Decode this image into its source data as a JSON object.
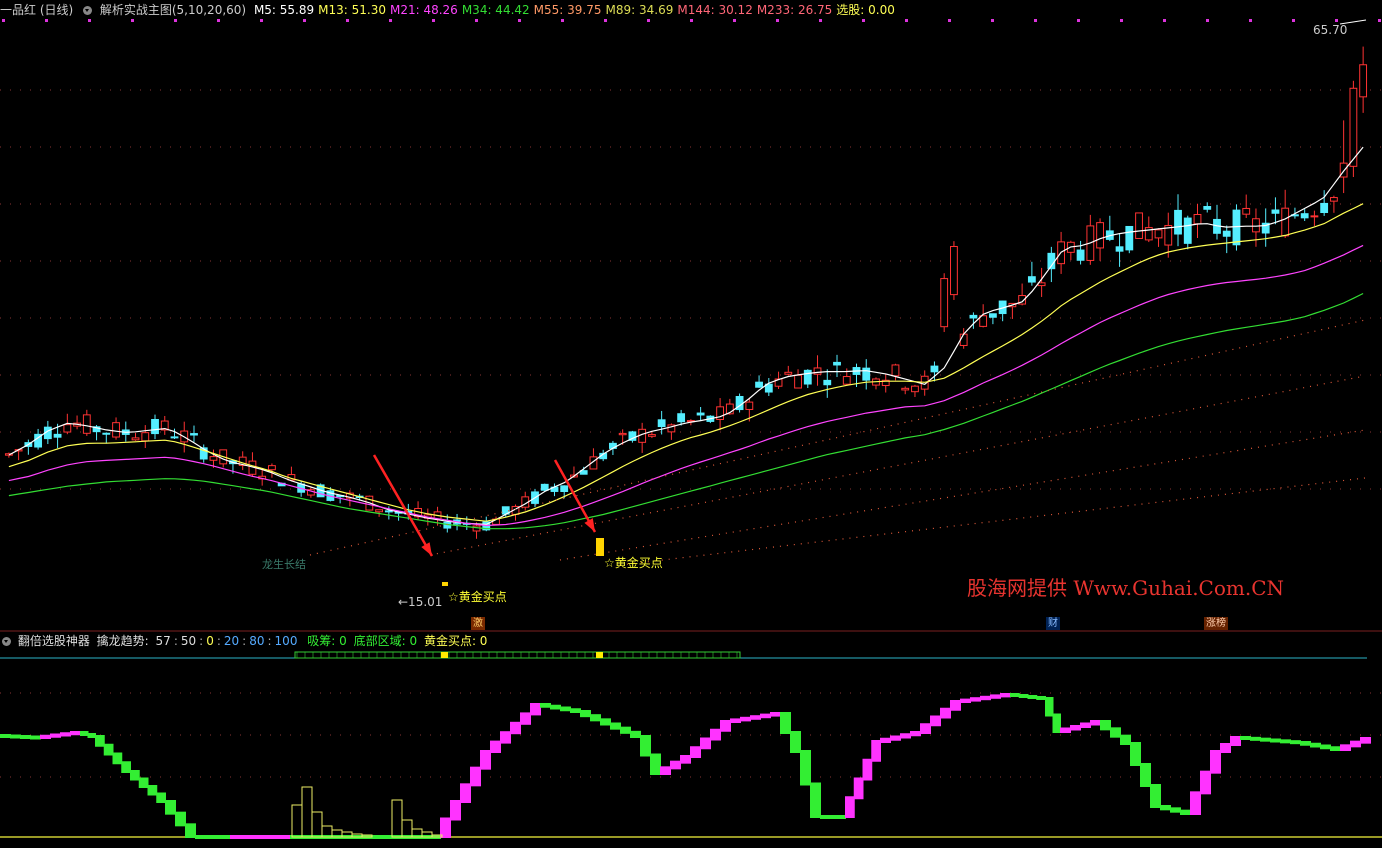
{
  "main_header": {
    "stock": "一品红 (日线)",
    "indicator": "解析实战主图(5,10,20,60)",
    "ma": [
      {
        "label": "M5: 55.89",
        "color": "#ffffff"
      },
      {
        "label": "M13: 51.30",
        "color": "#ffff55"
      },
      {
        "label": "M21: 48.26",
        "color": "#ff44ff"
      },
      {
        "label": "M34: 44.42",
        "color": "#33dd33"
      },
      {
        "label": "M55: 39.75",
        "color": "#ff9966"
      },
      {
        "label": "M89: 34.69",
        "color": "#dddd55"
      },
      {
        "label": "M144: 30.12",
        "color": "#ff6677"
      },
      {
        "label": "M233: 26.75",
        "color": "#ff6677"
      },
      {
        "label": "选股: 0.00",
        "color": "#ffff55"
      }
    ]
  },
  "annotations": {
    "high_price": "65.70",
    "low_price": "←15.01",
    "gold_buy_1": "☆黄金买点",
    "gold_buy_2": "☆黄金买点",
    "faded_label": "龙生长结",
    "event_1": "激",
    "event_2": "财",
    "event_3": "涨榜"
  },
  "watermark": "股海网提供 Www.Guhai.Com.CN",
  "sub_header": {
    "indicator": "翻倍选股神器",
    "trend_label": "擒龙趋势:",
    "levels": [
      {
        "text": "57",
        "color": "#dddddd"
      },
      {
        "text": "50",
        "color": "#dddddd"
      },
      {
        "text": "0",
        "color": "#ffff55"
      },
      {
        "text": "20",
        "color": "#55aaff"
      },
      {
        "text": "80",
        "color": "#55aaff"
      },
      {
        "text": "100",
        "color": "#55aaff"
      }
    ],
    "absorb": "吸筹: 0",
    "bottom_zone": "底部区域: 0",
    "gold_point": "黄金买点: 0"
  },
  "colors": {
    "up": "#ff3333",
    "down": "#55eeff",
    "ma5": "#ffffff",
    "ma13": "#ffff55",
    "ma21": "#ff44ff",
    "ma34": "#33dd33",
    "trend_up": "#ff33ff",
    "trend_down": "#33ee33",
    "grid_dot": "#883333",
    "watermark": "#e8342f"
  },
  "chart_data": {
    "type": "candlestick",
    "ylim": [
      13,
      68
    ],
    "x_count": 140,
    "series": [
      {
        "name": "M5",
        "values": [
          27.5,
          28.5,
          29.8,
          30.5,
          30.2,
          29.8,
          29.6,
          29.8,
          30.0,
          29.0,
          27.8,
          26.9,
          26.5,
          26.0,
          25.2,
          24.6,
          24.0,
          23.6,
          23.1,
          22.4,
          22.0,
          21.6,
          21.3,
          21.1,
          21.0,
          22.0,
          23.0,
          24.2,
          25.0,
          26.4,
          27.8,
          28.8,
          29.6,
          30.0,
          30.5,
          30.8,
          31.2,
          32.5,
          34.1,
          34.8,
          35.1,
          35.3,
          35.3,
          35.4,
          35.1,
          34.6,
          34.1,
          35.7,
          39.0,
          40.8,
          41.3,
          41.9,
          44.3,
          46.9,
          47.1,
          47.9,
          48.3,
          48.5,
          48.7,
          48.9,
          49.2,
          48.8,
          48.9,
          48.9,
          49.5,
          50.5,
          51.5,
          54.0,
          56.3
        ]
      },
      {
        "name": "M13",
        "values": [
          27.0,
          27.6,
          28.4,
          29.0,
          29.2,
          29.2,
          29.3,
          29.4,
          29.5,
          29.0,
          28.4,
          27.8,
          27.2,
          26.7,
          26.0,
          25.5,
          25.0,
          24.5,
          24.0,
          23.5,
          23.0,
          22.6,
          22.3,
          22.1,
          21.9,
          22.3,
          22.8,
          23.5,
          24.3,
          25.2,
          26.2,
          27.2,
          28.1,
          28.9,
          29.6,
          30.1,
          30.7,
          31.4,
          32.2,
          33.0,
          33.7,
          34.2,
          34.6,
          34.9,
          35.0,
          35.0,
          34.9,
          35.3,
          36.3,
          37.4,
          38.4,
          39.5,
          40.8,
          42.3,
          43.4,
          44.5,
          45.4,
          46.3,
          47.0,
          47.4,
          47.7,
          47.9,
          48.1,
          48.3,
          48.6,
          49.1,
          49.7,
          50.7,
          51.6
        ]
      },
      {
        "name": "M21",
        "values": [
          26.3,
          26.7,
          27.3,
          27.8,
          28.1,
          28.2,
          28.3,
          28.4,
          28.5,
          28.2,
          27.8,
          27.3,
          26.8,
          26.4,
          25.9,
          25.4,
          24.9,
          24.5,
          24.1,
          23.7,
          23.3,
          22.9,
          22.6,
          22.3,
          22.1,
          22.2,
          22.5,
          22.9,
          23.4,
          24.0,
          24.7,
          25.4,
          26.2,
          26.9,
          27.6,
          28.2,
          28.8,
          29.4,
          30.1,
          30.7,
          31.3,
          31.8,
          32.2,
          32.6,
          32.9,
          33.2,
          33.3,
          33.8,
          34.6,
          35.5,
          36.3,
          37.2,
          38.2,
          39.3,
          40.3,
          41.3,
          42.1,
          42.9,
          43.6,
          44.1,
          44.5,
          44.8,
          45.0,
          45.2,
          45.5,
          45.9,
          46.6,
          47.4,
          48.3
        ]
      },
      {
        "name": "M34",
        "values": [
          25.5,
          25.8,
          26.1,
          26.4,
          26.6,
          26.8,
          26.9,
          27.0,
          27.1,
          27.0,
          26.8,
          26.5,
          26.2,
          25.9,
          25.5,
          25.1,
          24.7,
          24.3,
          24.0,
          23.7,
          23.4,
          23.1,
          22.8,
          22.6,
          22.4,
          22.4,
          22.5,
          22.7,
          23.0,
          23.4,
          23.8,
          24.3,
          24.8,
          25.3,
          25.8,
          26.3,
          26.8,
          27.3,
          27.8,
          28.3,
          28.8,
          29.3,
          29.7,
          30.1,
          30.5,
          30.9,
          31.2,
          31.7,
          32.3,
          33.0,
          33.7,
          34.4,
          35.2,
          36.0,
          36.8,
          37.6,
          38.3,
          39.0,
          39.6,
          40.1,
          40.5,
          40.9,
          41.2,
          41.5,
          41.8,
          42.2,
          42.8,
          43.5,
          44.4
        ]
      }
    ],
    "high": 65.7,
    "low": 15.01,
    "sub_indicator": {
      "name": "擒龙趋势",
      "ylim": [
        0,
        100
      ]
    }
  }
}
